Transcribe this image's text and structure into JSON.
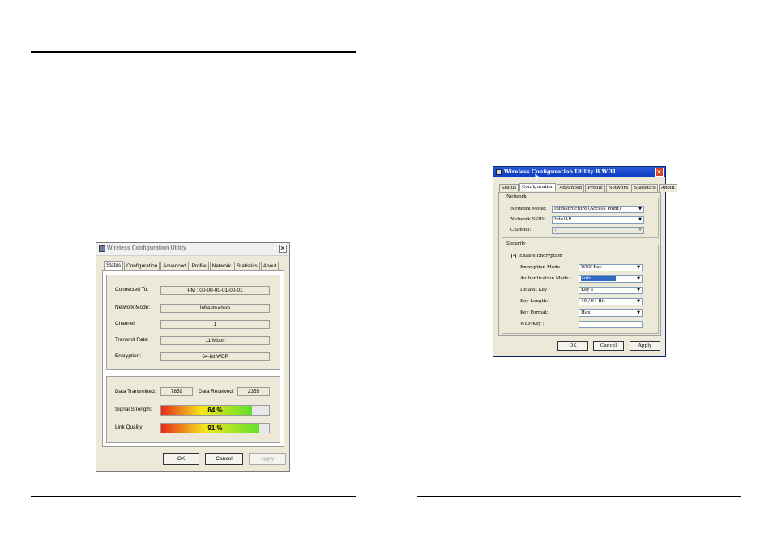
{
  "dialog1": {
    "title": "Wireless Configuration Utility",
    "close_glyph": "✕",
    "tabs": [
      "Status",
      "Configuration",
      "Advanced",
      "Profile",
      "Network",
      "Statistics",
      "About"
    ],
    "active_tab": "Status",
    "info": {
      "connected_to_label": "Connected To:",
      "connected_to_value": "PM : 00-00-00-01-00-01",
      "network_mode_label": "Network Mode:",
      "network_mode_value": "Infrastructure",
      "channel_label": "Channel:",
      "channel_value": "1",
      "transmit_rate_label": "Transmit Rate:",
      "transmit_rate_value": "11 Mbps",
      "encryption_label": "Encryption:",
      "encryption_value": "64-bit WEP"
    },
    "stats": {
      "data_transmitted_label": "Data Transmitted:",
      "data_transmitted_value": "7859",
      "data_received_label": "Data Received:",
      "data_received_value": "2355",
      "signal_strength_label": "Signal Strength:",
      "signal_strength_text": "84 %",
      "signal_strength_fraction": 0.84,
      "link_quality_label": "Link Quality:",
      "link_quality_text": "91 %",
      "link_quality_fraction": 0.91
    },
    "buttons": {
      "ok": "OK",
      "cancel": "Cancel",
      "apply": "Apply"
    }
  },
  "dialog2": {
    "title": "Wireless Configuration Utility B.W.31",
    "close_glyph": "✕",
    "tabs": [
      "Status",
      "Configuration",
      "Advanced",
      "Profile",
      "Network",
      "Statistics",
      "About"
    ],
    "active_tab": "Configuration",
    "network_section": {
      "title": "Network",
      "network_mode_label": "Network Mode:",
      "network_mode_value": "Infrastructure (Access Point)",
      "network_ssid_label": "Network SSID:",
      "network_ssid_value": "IntelAP",
      "channel_label": "Channel:",
      "channel_value": "1"
    },
    "security_section": {
      "title": "Security",
      "enable_encryption_label": "Enable Encryption",
      "enable_encryption_checked": true,
      "encryption_mode_label": "Encryption Mode :",
      "encryption_mode_value": "WEP-Key",
      "authentication_mode_label": "Authentication Mode :",
      "authentication_mode_value": "Auto",
      "default_key_label": "Default Key :",
      "default_key_value": "Key 1",
      "key_length_label": "Key Length:",
      "key_length_value": "40 / 64 Bit",
      "key_format_label": "Key Format:",
      "key_format_value": "Hex",
      "wep_key_label": "WEP-Key :",
      "wep_key_value": ""
    },
    "buttons": {
      "ok": "OK",
      "cancel": "Cancel",
      "apply": "Apply"
    }
  },
  "colors": {
    "titlebar_active": "#0a3bbf",
    "dialog_bg": "#ece9d8",
    "selection": "#316ac5"
  },
  "icons": {
    "dropdown": "▼",
    "check": "✓"
  }
}
